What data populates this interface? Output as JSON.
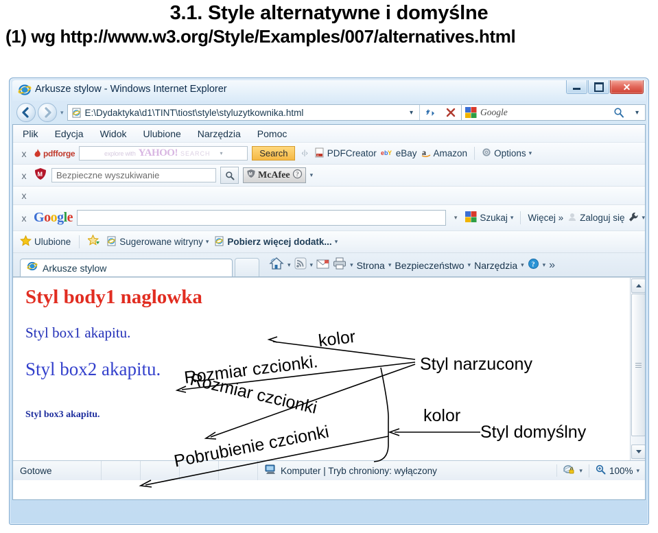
{
  "slide": {
    "title": "3.1. Style alternatywne i domyślne",
    "subtitle": "(1) wg http://www.w3.org/Style/Examples/007/alternatives.html"
  },
  "browser": {
    "window_title": "Arkusze stylow - Windows Internet Explorer",
    "window_controls": {
      "minimize": "minimize-button",
      "maximize": "maximize-button",
      "close": "✕"
    },
    "address_bar": {
      "value": "E:\\Dydaktyka\\d1\\TINT\\tiost\\style\\styluzytkownika.html"
    },
    "nav_search": {
      "placeholder": "Google"
    },
    "menu": [
      {
        "pre": "P",
        "rest": "lik"
      },
      {
        "pre": "E",
        "rest": "dycja"
      },
      {
        "pre": "W",
        "rest": "idok"
      },
      {
        "pre": "U",
        "rest": "lubione"
      },
      {
        "pre": "N",
        "rest": "arzędzia"
      },
      {
        "pre": "Pomo",
        "rest": "c"
      }
    ],
    "menu_labels": [
      "Plik",
      "Edycja",
      "Widok",
      "Ulubione",
      "Narzędzia",
      "Pomoc"
    ],
    "pdfforge_toolbar": {
      "close_label": "x",
      "brand": "pdfforge",
      "search_hint_pre": "explore with",
      "search_hint_logo": "YAHOO!",
      "search_hint_post": "SEARCH",
      "search_button": "Search",
      "buttons": [
        "PDFCreator",
        "eBay",
        "Amazon",
        "Options"
      ]
    },
    "mcafee_toolbar": {
      "close_label": "x",
      "search_placeholder": "Bezpieczne wyszukiwanie",
      "brand": "McAfee"
    },
    "empty_toolbar": {
      "close_label": "x"
    },
    "google_toolbar": {
      "close_label": "x",
      "brand": "Google",
      "query": "",
      "buttons": [
        "Szukaj",
        "Więcej »",
        "Zaloguj się"
      ]
    },
    "favorites_bar": {
      "favorites_label": "Ulubione",
      "items": [
        "Sugerowane witryny",
        "Pobierz więcej dodatk..."
      ]
    },
    "tab": {
      "label": "Arkusze stylow"
    },
    "command_bar": {
      "items": [
        "Strona",
        "Bezpieczeństwo",
        "Narzędzia"
      ],
      "overflow": "»"
    },
    "status_bar": {
      "status": "Gotowe",
      "zone": "Komputer | Tryb chroniony: wyłączony",
      "zoom": "100%"
    }
  },
  "page_content": {
    "heading": "Styl body1 naglowka",
    "para1": "Styl box1 akapitu.",
    "para2": "Styl box2 akapitu.",
    "para3": "Styl box3 akapitu.",
    "colors": {
      "heading": "#e12d21",
      "para": "#2330b8"
    }
  },
  "annotations": {
    "kolor_top": "kolor",
    "rozmiar_czcionki_1": "Rozmiar czcionki.",
    "rozmiar_czcionki_2": "Rozmiar czcionki",
    "pobrubienie": "Pobrubienie czcionki",
    "styl_narzucony": "Styl narzucony",
    "kolor_bottom": "kolor",
    "styl_domyslny": "Styl domyślny"
  }
}
